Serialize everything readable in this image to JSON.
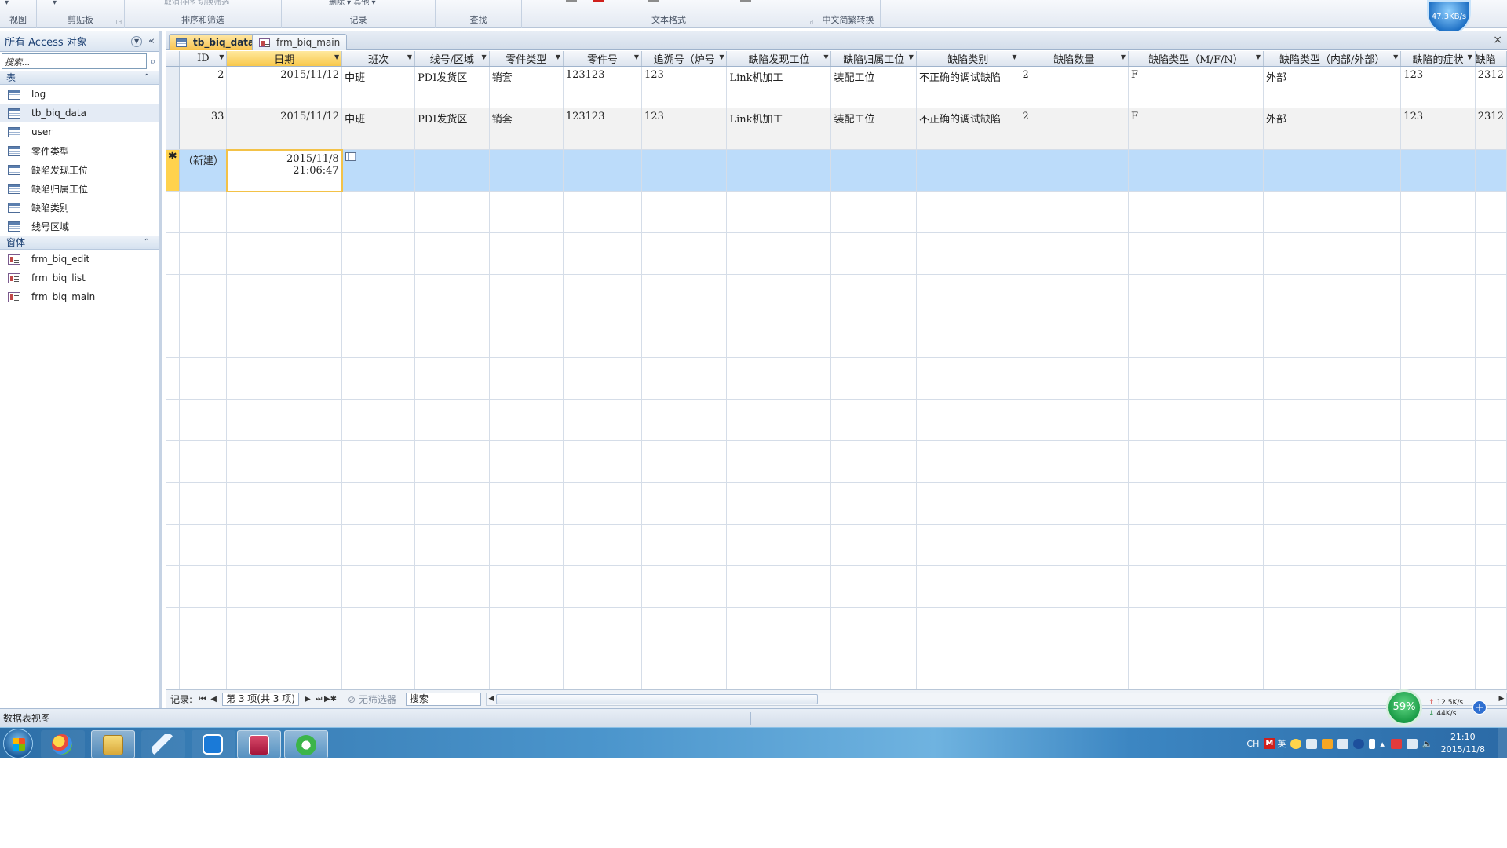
{
  "ribbon": {
    "groups": [
      {
        "label": "视图",
        "top": ""
      },
      {
        "label": "剪贴板",
        "top": ""
      },
      {
        "label": "排序和筛选",
        "top": "取消排序    切换筛选"
      },
      {
        "label": "记录",
        "top": "删除 ▾   其他 ▾"
      },
      {
        "label": "查找",
        "top": ""
      },
      {
        "label": "文本格式",
        "top": ""
      },
      {
        "label": "中文简繁转换",
        "top": ""
      }
    ],
    "speed": "47.3KB/s"
  },
  "nav": {
    "title": "所有 Access 对象",
    "search_placeholder": "搜索...",
    "sections": [
      {
        "label": "表",
        "items": [
          {
            "label": "log",
            "type": "table"
          },
          {
            "label": "tb_biq_data",
            "type": "table"
          },
          {
            "label": "user",
            "type": "table"
          },
          {
            "label": "零件类型",
            "type": "table"
          },
          {
            "label": "缺陷发现工位",
            "type": "table"
          },
          {
            "label": "缺陷归属工位",
            "type": "table"
          },
          {
            "label": "缺陷类别",
            "type": "table"
          },
          {
            "label": "线号区域",
            "type": "table"
          }
        ]
      },
      {
        "label": "窗体",
        "items": [
          {
            "label": "frm_biq_edit",
            "type": "form"
          },
          {
            "label": "frm_biq_list",
            "type": "form"
          },
          {
            "label": "frm_biq_main",
            "type": "form"
          }
        ]
      }
    ]
  },
  "tabs": [
    {
      "label": "tb_biq_data",
      "active": true
    },
    {
      "label": "frm_biq_main",
      "active": false
    }
  ],
  "grid": {
    "columns": [
      "ID",
      "日期",
      "班次",
      "线号/区域",
      "零件类型",
      "零件号",
      "追溯号（炉号",
      "缺陷发现工位",
      "缺陷归属工位",
      "缺陷类别",
      "缺陷数量",
      "缺陷类型（M/F/N）",
      "缺陷类型（内部/外部）",
      "缺陷的症状",
      "缺陷"
    ],
    "rows": [
      [
        "2",
        "2015/11/12",
        "中班",
        "PDI发货区",
        "销套",
        "123123",
        "123",
        "Link机加工",
        "装配工位",
        "不正确的调试缺陷",
        "2",
        "F",
        "外部",
        "123",
        "2312"
      ],
      [
        "33",
        "2015/11/12",
        "中班",
        "PDI发货区",
        "销套",
        "123123",
        "123",
        "Link机加工",
        "装配工位",
        "不正确的调试缺陷",
        "2",
        "F",
        "外部",
        "123",
        "2312"
      ]
    ],
    "new_row": {
      "marker": "✱",
      "id_label": "（新建）",
      "date_line1": "2015/11/8",
      "date_line2": "21:06:47"
    }
  },
  "recnav": {
    "label": "记录:",
    "position": "第 3 项(共 3 项)",
    "filter": "无筛选器",
    "search": "搜索"
  },
  "status": {
    "text": "数据表视图"
  },
  "network": {
    "percent": "59%",
    "up": "12.5K/s",
    "down": "44K/s"
  },
  "taskbar": {
    "lang": "CH",
    "ime": "英",
    "time": "21:10",
    "date": "2015/11/8"
  },
  "colors": {
    "accent": "#f7c24d",
    "selection": "#bcdcfa"
  }
}
